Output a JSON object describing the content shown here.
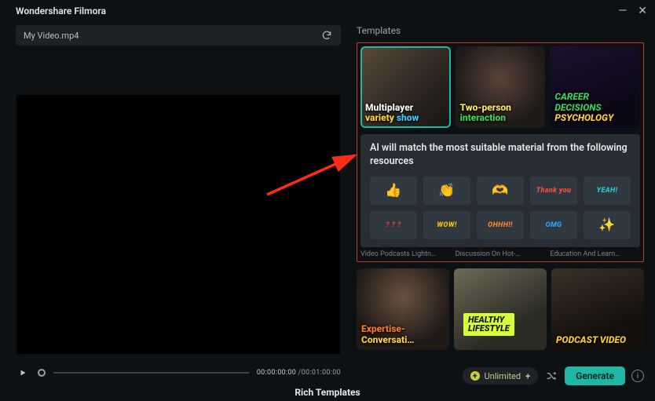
{
  "app": {
    "title": "Wondershare Filmora"
  },
  "file": {
    "name": "My Video.mp4"
  },
  "transport": {
    "current_time": "00:00:00:00",
    "total_time": "/00:01:00:00"
  },
  "templates": {
    "label": "Templates",
    "row1": [
      {
        "line1": "Multiplayer",
        "line2": "variety",
        "line3": "show"
      },
      {
        "line1": "Two-person",
        "line2": "interaction"
      },
      {
        "line1": "CAREER  DECISIONS",
        "line2": "PSYCHOLOGY"
      }
    ],
    "row2_labels": [
      "Video Podcasts Lightn…",
      "Discussion On Hot-…",
      "Education And Learn…"
    ],
    "row3": [
      {
        "line1": "Expertise-",
        "line2": "Conversati…"
      },
      {
        "badge_l1": "HEALTHY",
        "badge_l2": "LIFESTYLE"
      },
      {
        "line1": "PODCAST VIDEO"
      }
    ]
  },
  "match": {
    "text": "AI will match the most suitable material from the following resources",
    "stickers": [
      {
        "name": "thumbs-up",
        "glyph": "👍"
      },
      {
        "name": "clap",
        "glyph": "👏"
      },
      {
        "name": "heart-hands",
        "glyph": "🫶"
      },
      {
        "name": "thank-you",
        "text": "Thank you"
      },
      {
        "name": "yeah",
        "text": "YEAH!"
      },
      {
        "name": "question",
        "text": "? ? ?"
      },
      {
        "name": "wow",
        "text": "WOW!"
      },
      {
        "name": "ohhh",
        "text": "OHHH!!"
      },
      {
        "name": "omg",
        "text": "OMG"
      },
      {
        "name": "sparkle",
        "glyph": "✨"
      }
    ]
  },
  "footer": {
    "unlimited": "Unlimited",
    "generate": "Generate",
    "caption": "Rich Templates"
  }
}
